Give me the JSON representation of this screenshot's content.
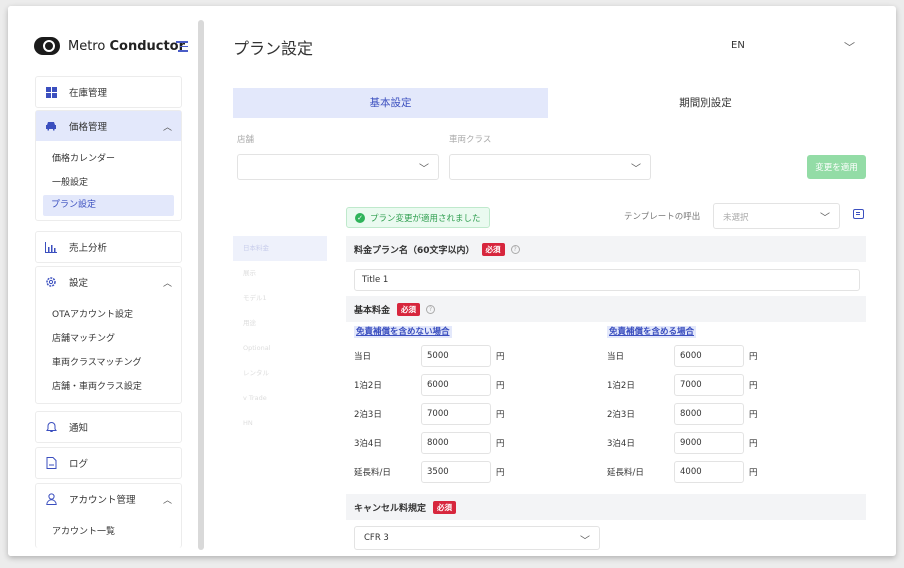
{
  "brand": {
    "name_prefix": "Metro",
    "name_bold": "Conductor"
  },
  "sidebar": {
    "inventory": "在庫管理",
    "pricing": "価格管理",
    "pricing_items": [
      "価格カレンダー",
      "一般設定",
      "プラン設定"
    ],
    "sales": "売上分析",
    "settings": "設定",
    "settings_items": [
      "OTAアカウント設定",
      "店舗マッチング",
      "車両クラスマッチング",
      "店舗・車両クラス設定"
    ],
    "notify": "通知",
    "log": "ログ",
    "account": "アカウント管理",
    "account_items": [
      "アカウント一覧"
    ]
  },
  "header": {
    "title": "プラン設定",
    "language": "EN"
  },
  "tabs": {
    "basic": "基本設定",
    "period": "期間別設定"
  },
  "filters": {
    "store_label": "店舗",
    "class_label": "車両クラス",
    "apply_label": "変更を適用"
  },
  "alert": {
    "message": "プラン変更が適用されました"
  },
  "template": {
    "label": "テンプレートの呼出",
    "value": "未選択"
  },
  "side_list": [
    "日本料金",
    "展示",
    "モデル1",
    "用途",
    "Optional",
    "レンタル",
    "v Trade",
    "HN"
  ],
  "form": {
    "name_label": "料金プラン名（60文字以内）",
    "required": "必須",
    "help": "?",
    "name_value": "Title 1",
    "base_label": "基本料金",
    "col_a_title": "免責補償を含めない場合",
    "col_b_title": "免責補償を含める場合",
    "yen": "円",
    "rows_a": [
      {
        "label": "当日",
        "value": "5000"
      },
      {
        "label": "1泊2日",
        "value": "6000"
      },
      {
        "label": "2泊3日",
        "value": "7000"
      },
      {
        "label": "3泊4日",
        "value": "8000"
      },
      {
        "label": "延長料/日",
        "value": "3500"
      }
    ],
    "rows_b": [
      {
        "label": "当日",
        "value": "6000"
      },
      {
        "label": "1泊2日",
        "value": "7000"
      },
      {
        "label": "2泊3日",
        "value": "8000"
      },
      {
        "label": "3泊4日",
        "value": "9000"
      },
      {
        "label": "延長料/日",
        "value": "4000"
      }
    ],
    "cancel_label": "キャンセル料規定",
    "cancel_value": "CFR 3"
  },
  "colors": {
    "accent": "#3b4fbf",
    "active_bg": "#e3e8fb",
    "required": "#d7263d",
    "success": "#2fb35a",
    "apply": "#93dca6"
  },
  "icons": {
    "inventory": "grid-icon",
    "pricing": "car-icon",
    "sales": "bar-chart-icon",
    "settings": "gear-icon",
    "notify": "bell-icon",
    "log": "log-icon",
    "account": "user-icon"
  }
}
